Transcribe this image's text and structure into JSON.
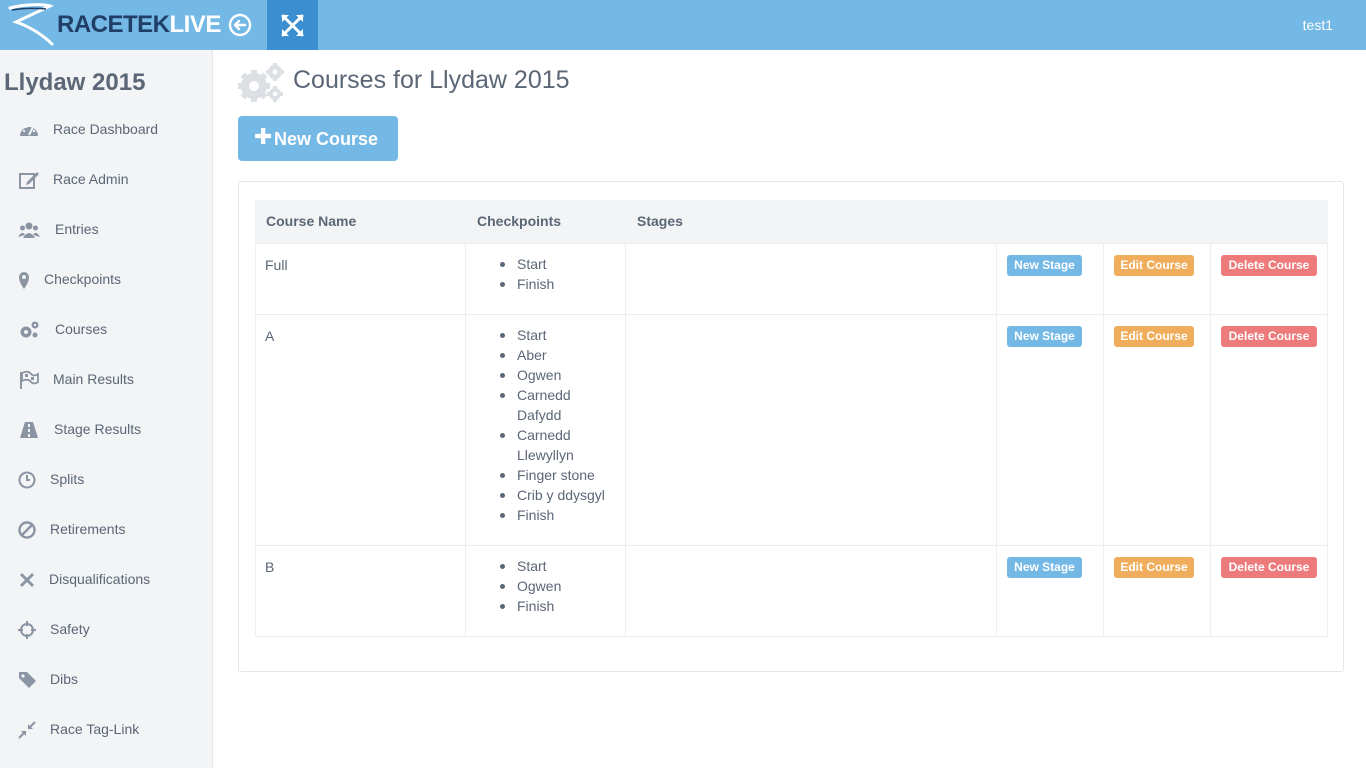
{
  "brand": {
    "part1": "RACETEK",
    "part2": "LIVE"
  },
  "user": "test1",
  "sidebar": {
    "race_title": "Llydaw 2015",
    "items": [
      {
        "label": "Race Dashboard",
        "icon": "dashboard-icon"
      },
      {
        "label": "Race Admin",
        "icon": "edit-icon"
      },
      {
        "label": "Entries",
        "icon": "users-icon"
      },
      {
        "label": "Checkpoints",
        "icon": "map-marker-icon"
      },
      {
        "label": "Courses",
        "icon": "cogs-icon"
      },
      {
        "label": "Main Results",
        "icon": "flag-icon"
      },
      {
        "label": "Stage Results",
        "icon": "road-icon"
      },
      {
        "label": "Splits",
        "icon": "clock-icon"
      },
      {
        "label": "Retirements",
        "icon": "ban-icon"
      },
      {
        "label": "Disqualifications",
        "icon": "times-icon"
      },
      {
        "label": "Safety",
        "icon": "crosshairs-icon"
      },
      {
        "label": "Dibs",
        "icon": "tag-icon"
      },
      {
        "label": "Race Tag-Link",
        "icon": "compress-icon"
      }
    ]
  },
  "main": {
    "title": "Courses for Llydaw 2015",
    "new_course_label": "New Course",
    "table": {
      "headers": [
        "Course Name",
        "Checkpoints",
        "Stages"
      ],
      "actions": {
        "new_stage": "New Stage",
        "edit_course": "Edit Course",
        "delete_course": "Delete Course"
      },
      "rows": [
        {
          "name": "Full",
          "checkpoints": [
            "Start",
            "Finish"
          ],
          "stages": ""
        },
        {
          "name": "A",
          "checkpoints": [
            "Start",
            "Aber",
            "Ogwen",
            "Carnedd Dafydd",
            "Carnedd Llewyllyn",
            "Finger stone",
            "Crib y ddysgyl",
            "Finish"
          ],
          "stages": ""
        },
        {
          "name": "B",
          "checkpoints": [
            "Start",
            "Ogwen",
            "Finish"
          ],
          "stages": ""
        }
      ]
    }
  },
  "colors": {
    "topbar": "#74b8e6",
    "topbar_active": "#3b8fd1",
    "btn_primary": "#74b8e6",
    "btn_warning": "#f0ad5c",
    "btn_danger": "#ee7b7b"
  }
}
